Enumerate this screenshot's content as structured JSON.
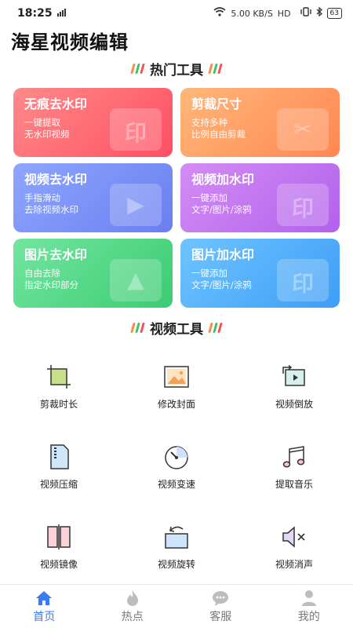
{
  "status": {
    "time": "18:25",
    "net_speed": "5.00 KB/S",
    "net_type": "HD",
    "battery": "63"
  },
  "app": {
    "title": "海星视频编辑"
  },
  "hot_tools": {
    "title": "热门工具",
    "cards": [
      {
        "title": "无痕去水印",
        "desc1": "一键提取",
        "desc2": "无水印视频",
        "deco": "印"
      },
      {
        "title": "剪裁尺寸",
        "desc1": "支持多种",
        "desc2": "比例自由剪裁",
        "deco": "✂"
      },
      {
        "title": "视频去水印",
        "desc1": "手指滑动",
        "desc2": "去除视频水印",
        "deco": "▶"
      },
      {
        "title": "视频加水印",
        "desc1": "一键添加",
        "desc2": "文字/图片/涂鸦",
        "deco": "印"
      },
      {
        "title": "图片去水印",
        "desc1": "自由去除",
        "desc2": "指定水印部分",
        "deco": "▲"
      },
      {
        "title": "图片加水印",
        "desc1": "一键添加",
        "desc2": "文字/图片/涂鸦",
        "deco": "印"
      }
    ]
  },
  "video_tools": {
    "title": "视频工具",
    "items": [
      {
        "label": "剪裁时长",
        "icon": "crop-icon"
      },
      {
        "label": "修改封面",
        "icon": "image-icon"
      },
      {
        "label": "视频倒放",
        "icon": "rewind-icon"
      },
      {
        "label": "视频压缩",
        "icon": "zip-icon"
      },
      {
        "label": "视频变速",
        "icon": "speed-icon"
      },
      {
        "label": "提取音乐",
        "icon": "music-icon"
      },
      {
        "label": "视频镜像",
        "icon": "mirror-icon"
      },
      {
        "label": "视频旋转",
        "icon": "rotate-icon"
      },
      {
        "label": "视频消声",
        "icon": "mute-icon"
      }
    ]
  },
  "nav": {
    "items": [
      {
        "label": "首页",
        "icon": "home-icon"
      },
      {
        "label": "热点",
        "icon": "fire-icon"
      },
      {
        "label": "客服",
        "icon": "chat-icon"
      },
      {
        "label": "我的",
        "icon": "user-icon"
      }
    ],
    "active_color": "#3a7bf0"
  }
}
